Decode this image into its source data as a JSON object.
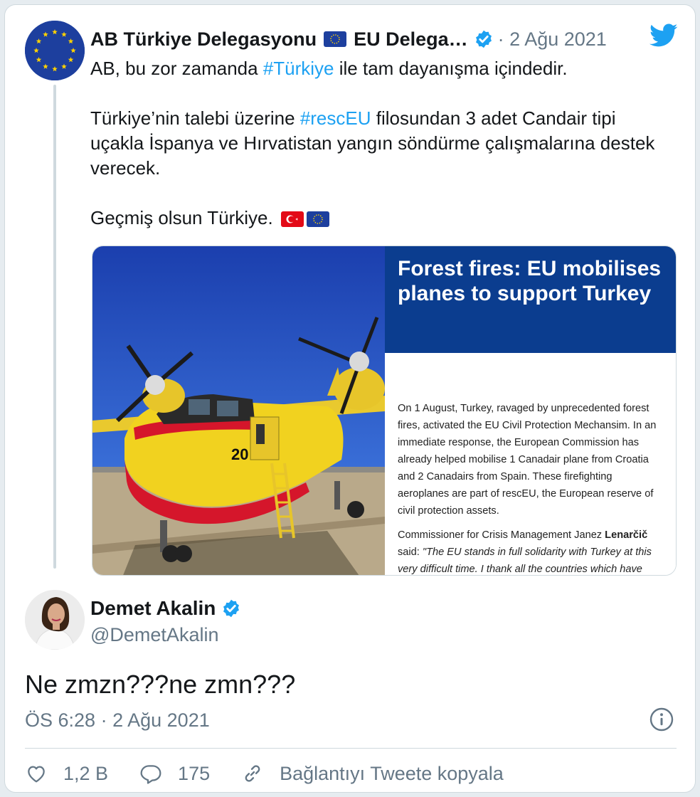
{
  "parent_tweet": {
    "author_name": "AB Türkiye Delegasyonu",
    "author_name_2": "EU Delega…",
    "date": "2 Ağu 2021",
    "separator": "·",
    "paragraphs": [
      [
        {
          "t": "AB, bu zor zamanda "
        },
        {
          "t": "#Türkiye",
          "tag": true
        },
        {
          "t": " ile tam dayanışma içindedir."
        }
      ],
      [
        {
          "t": "Türkiye’nin talebi üzerine "
        },
        {
          "t": "#rescEU",
          "tag": true
        },
        {
          "t": " filosundan 3 adet Candair tipi uçakla İspanya ve Hırvatistan yangın söndürme çalışmalarına destek verecek."
        }
      ],
      [
        {
          "t": "Geçmiş olsun Türkiye. "
        }
      ]
    ],
    "media": {
      "article_title": "Forest fires: EU mobilises planes to support Turkey",
      "article_p1": "On 1 August, Turkey, ravaged by unprecedented forest fires, activated the EU Civil Protection Mechansim. In an immediate response, the European Commission has already helped mobilise 1 Canadair plane from Croatia and 2 Canadairs from Spain. These firefighting aeroplanes are part of rescEU, the European reserve of civil protection assets.",
      "article_p2_prefix": "Commissioner for Crisis Management Janez ",
      "article_p2_name": "Lenarčič",
      "article_p2_said": " said: ",
      "article_p2_quote": "\"The EU stands in full solidarity with Turkey at this very difficult time. I thank all the countries which have",
      "plane_number": "20"
    }
  },
  "reply_tweet": {
    "author_name": "Demet Akalin",
    "handle": "@DemetAkalin",
    "text": "Ne zmzn???ne zmn???",
    "time": "ÖS 6:28",
    "separator": "·",
    "date": "2 Ağu 2021",
    "likes": "1,2 B",
    "replies": "175",
    "copy_link": "Bağlantıyı Tweete kopyala"
  },
  "colors": {
    "accent": "#1da1f2",
    "secondary_text": "#657786",
    "eu_blue": "#0b3d8f"
  },
  "icons": [
    "twitter-bird-icon",
    "verified-badge-icon",
    "eu-flag-icon",
    "turkey-flag-icon",
    "info-icon",
    "heart-icon",
    "reply-icon",
    "link-icon"
  ]
}
